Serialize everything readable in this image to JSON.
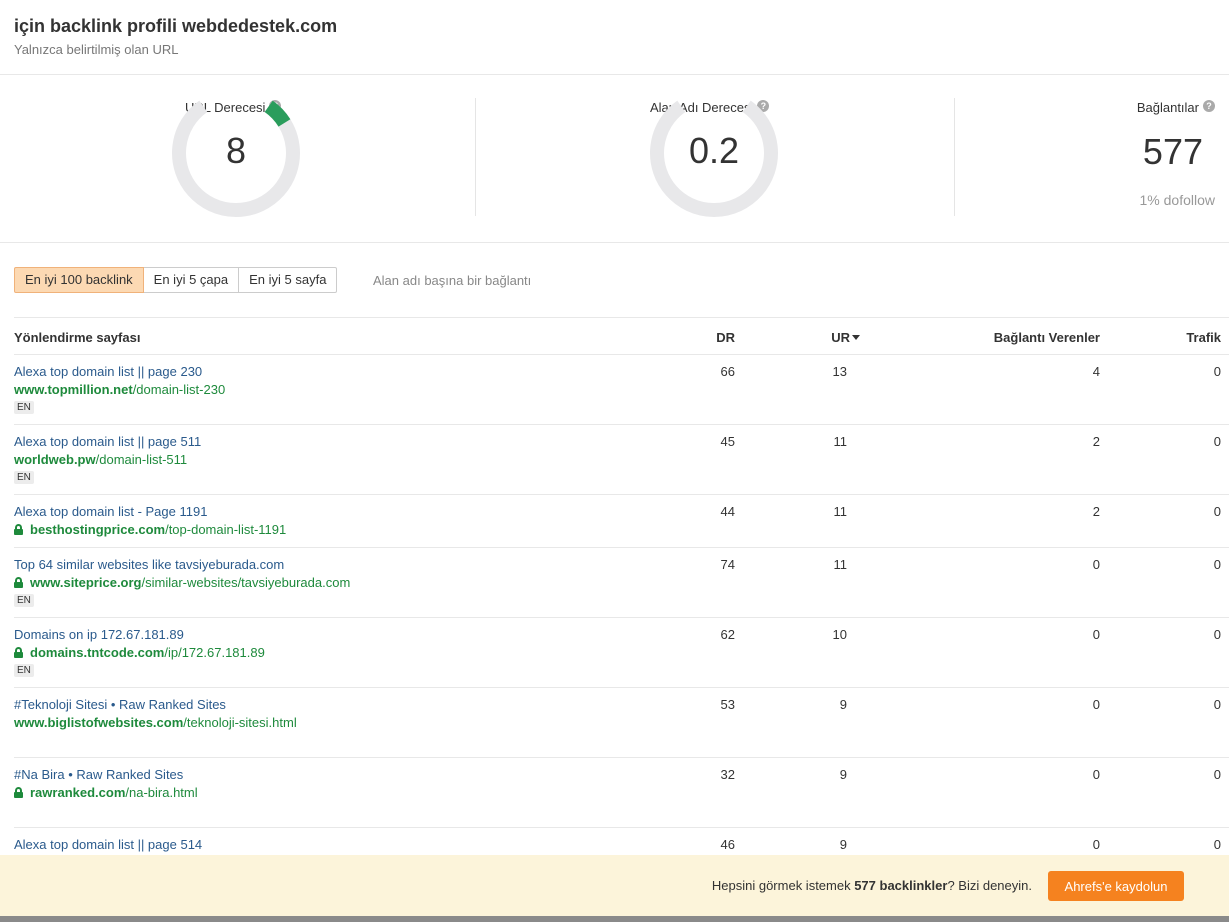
{
  "header": {
    "title": "için backlink profili webdedestek.com",
    "subtitle": "Yalnızca belirtilmiş olan URL"
  },
  "metrics": {
    "url_rating": {
      "label": "URL Derecesi",
      "value": "8",
      "gauge_fraction": 0.08
    },
    "domain_rating": {
      "label": "Alan Adı Derecesi",
      "value": "0.2",
      "gauge_fraction": 0.002
    },
    "backlinks": {
      "label": "Bağlantılar",
      "value": "577",
      "dofollow": "1% dofollow"
    },
    "help_icon_text": "?"
  },
  "tabs": {
    "items": [
      {
        "label": "En iyi 100 backlink",
        "active": true
      },
      {
        "label": "En iyi 5 çapa",
        "active": false
      },
      {
        "label": "En iyi 5 sayfa",
        "active": false
      }
    ],
    "hint": "Alan adı başına bir bağlantı"
  },
  "table": {
    "columns": {
      "page": "Yönlendirme sayfası",
      "dr": "DR",
      "ur": "UR",
      "referring": "Bağlantı Verenler",
      "traffic": "Trafik"
    },
    "rows": [
      {
        "title": "Alexa top domain list || page 230",
        "domain": "www.topmillion.net",
        "path": "/domain-list-230",
        "secure": false,
        "lang": "EN",
        "dr": "66",
        "ur": "13",
        "referring": "4",
        "traffic": "0"
      },
      {
        "title": "Alexa top domain list || page 511",
        "domain": "worldweb.pw",
        "path": "/domain-list-511",
        "secure": false,
        "lang": "EN",
        "dr": "45",
        "ur": "11",
        "referring": "2",
        "traffic": "0"
      },
      {
        "title": "Alexa top domain list - Page 1191",
        "domain": "besthostingprice.com",
        "path": "/top-domain-list-1191",
        "secure": true,
        "lang": "",
        "dr": "44",
        "ur": "11",
        "referring": "2",
        "traffic": "0"
      },
      {
        "title": "Top 64 similar websites like tavsiyeburada.com",
        "domain": "www.siteprice.org",
        "path": "/similar-websites/tavsiyeburada.com",
        "secure": true,
        "lang": "EN",
        "dr": "74",
        "ur": "11",
        "referring": "0",
        "traffic": "0"
      },
      {
        "title": "Domains on ip 172.67.181.89",
        "domain": "domains.tntcode.com",
        "path": "/ip/172.67.181.89",
        "secure": true,
        "lang": "EN",
        "dr": "62",
        "ur": "10",
        "referring": "0",
        "traffic": "0"
      },
      {
        "title": "#Teknoloji Sitesi • Raw Ranked Sites",
        "domain": "www.biglistofwebsites.com",
        "path": "/teknoloji-sitesi.html",
        "secure": false,
        "lang": "",
        "dr": "53",
        "ur": "9",
        "referring": "0",
        "traffic": "0"
      },
      {
        "title": "#Na Bira • Raw Ranked Sites",
        "domain": "rawranked.com",
        "path": "/na-bira.html",
        "secure": true,
        "lang": "",
        "dr": "32",
        "ur": "9",
        "referring": "0",
        "traffic": "0"
      },
      {
        "title": "Alexa top domain list || page 514",
        "domain": "",
        "path": "",
        "secure": false,
        "lang": "",
        "dr": "46",
        "ur": "9",
        "referring": "0",
        "traffic": "0"
      }
    ]
  },
  "footer": {
    "text_before": "Hepsini görmek istemek ",
    "text_bold": "577 backlinkler",
    "text_after": "? Bizi deneyin.",
    "button_label": "Ahrefs'e kaydolun"
  },
  "colors": {
    "gauge_track": "#e8e8ea",
    "gauge_fill": "#2a9d5c",
    "link_title": "#2a5a8c",
    "link_url": "#1e8a3c",
    "accent_button": "#f5821f",
    "active_tab": "#fcd9b3",
    "footer_bg": "#fcf4da"
  }
}
